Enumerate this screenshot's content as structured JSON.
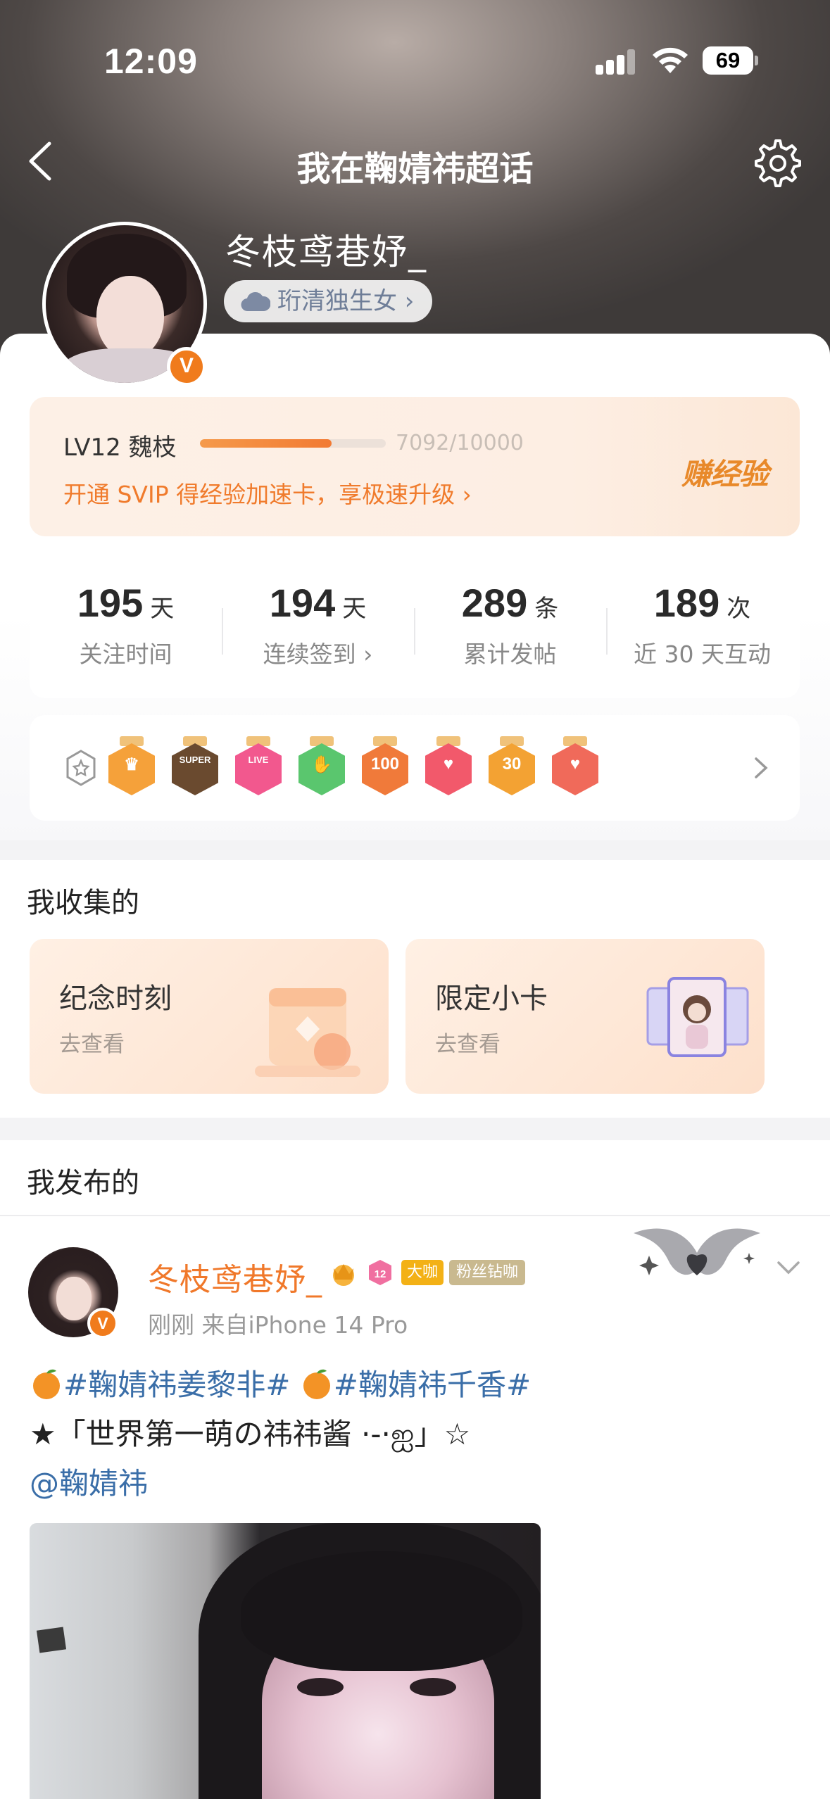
{
  "status_bar": {
    "time": "12:09",
    "battery": "69"
  },
  "nav": {
    "title": "我在鞠婧祎超话"
  },
  "profile": {
    "username": "冬枝鸢巷妤_",
    "tag": "珩清独生女 ›",
    "verified": "V"
  },
  "level": {
    "label": "LV12 魏枝",
    "progress_text": "7092/10000",
    "progress_fraction": 0.7092,
    "promo": "开通 SVIP 得经验加速卡，享极速升级 ›",
    "earn_button": "赚经验"
  },
  "stats": [
    {
      "value": "195",
      "unit": "天",
      "label": "关注时间"
    },
    {
      "value": "194",
      "unit": "天",
      "label": "连续签到 ›"
    },
    {
      "value": "289",
      "unit": "条",
      "label": "累计发帖"
    },
    {
      "value": "189",
      "unit": "次",
      "label": "近 30 天互动"
    }
  ],
  "badges": [
    {
      "icon": "crown-medal-icon",
      "color": "#f5a13a",
      "symbol": "♛"
    },
    {
      "icon": "super-medal-icon",
      "color": "#6a4a2f",
      "symbol": "SUPER"
    },
    {
      "icon": "live-medal-icon",
      "color": "#f2588e",
      "symbol": "LIVE"
    },
    {
      "icon": "hand-medal-icon",
      "color": "#5ac66e",
      "symbol": "✋"
    },
    {
      "icon": "100-days-medal-icon",
      "color": "#f07a3a",
      "symbol": "100"
    },
    {
      "icon": "heart-medal-icon",
      "color": "#f2596b",
      "symbol": "♥"
    },
    {
      "icon": "30-days-medal-icon",
      "color": "#f3a233",
      "symbol": "30"
    },
    {
      "icon": "hand-heart-medal-icon",
      "color": "#f06a5a",
      "symbol": "♥"
    }
  ],
  "collection": {
    "title": "我收集的",
    "cards": [
      {
        "title": "纪念时刻",
        "sub": "去查看"
      },
      {
        "title": "限定小卡",
        "sub": "去查看"
      }
    ]
  },
  "posts_section": {
    "title": "我发布的"
  },
  "post": {
    "author": "冬枝鸢巷妤_",
    "level_badge": "12",
    "big_coffee": "大咖",
    "fan_tag": "粉丝钻咖",
    "meta": "刚刚  来自iPhone 14 Pro",
    "hashtag1": "#鞠婧祎姜黎非#",
    "hashtag2": "#鞠婧祎千香#",
    "line2": "★「世界第一萌の祎祎酱 ·-·ஐ」☆",
    "mention": "@鞠婧祎"
  },
  "colors": {
    "accent_orange": "#f07b2c",
    "link_blue": "#3a6ea8"
  }
}
